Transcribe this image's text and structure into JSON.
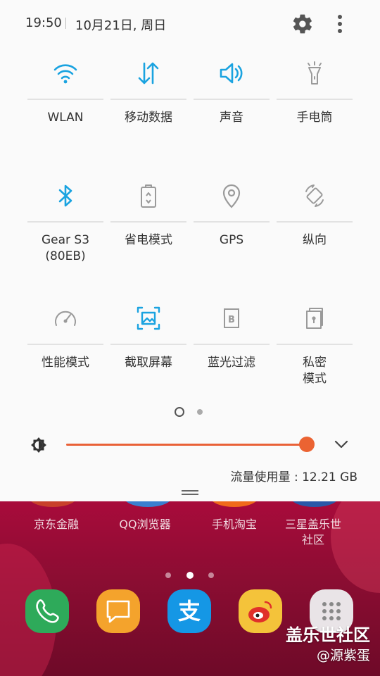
{
  "status": {
    "time": "19:50",
    "date": "10月21日, 周日"
  },
  "header_icons": {
    "settings": "gear-icon",
    "more": "more-vertical-icon"
  },
  "tiles": [
    {
      "label": "WLAN",
      "icon": "wifi-icon",
      "active": true
    },
    {
      "label": "移动数据",
      "icon": "mobile-data-icon",
      "active": true
    },
    {
      "label": "声音",
      "icon": "sound-icon",
      "active": true
    },
    {
      "label": "手电筒",
      "icon": "flashlight-icon",
      "active": false
    },
    {
      "label": "Gear S3\n(80EB)",
      "icon": "bluetooth-icon",
      "active": true
    },
    {
      "label": "省电模式",
      "icon": "battery-saver-icon",
      "active": false
    },
    {
      "label": "GPS",
      "icon": "location-icon",
      "active": false
    },
    {
      "label": "纵向",
      "icon": "rotation-icon",
      "active": false
    },
    {
      "label": "性能模式",
      "icon": "speedometer-icon",
      "active": false
    },
    {
      "label": "截取屏幕",
      "icon": "screenshot-icon",
      "active": true
    },
    {
      "label": "蓝光过滤",
      "icon": "blue-light-filter-icon",
      "active": false
    },
    {
      "label": "私密\n模式",
      "icon": "private-mode-icon",
      "active": false
    }
  ],
  "pager": {
    "current": 1,
    "total": 2
  },
  "brightness": {
    "icon": "brightness-icon",
    "level": 1.0
  },
  "data_usage": "流量使用量 : 12.21 GB",
  "home": {
    "apps": [
      "京东金融",
      "QQ浏览器",
      "手机淘宝",
      "三星盖乐世\n社区"
    ],
    "page_dots": {
      "current": 2,
      "total": 3
    },
    "dock": [
      "phone-icon",
      "messages-icon",
      "alipay-icon",
      "weibo-icon",
      "app-drawer-icon"
    ]
  },
  "watermark": {
    "line1": "盖乐世社区",
    "line2": "@源紫蛋"
  },
  "colors": {
    "active": "#1aa3e0",
    "inactive": "#9a9a9a",
    "accent": "#eb6332"
  }
}
